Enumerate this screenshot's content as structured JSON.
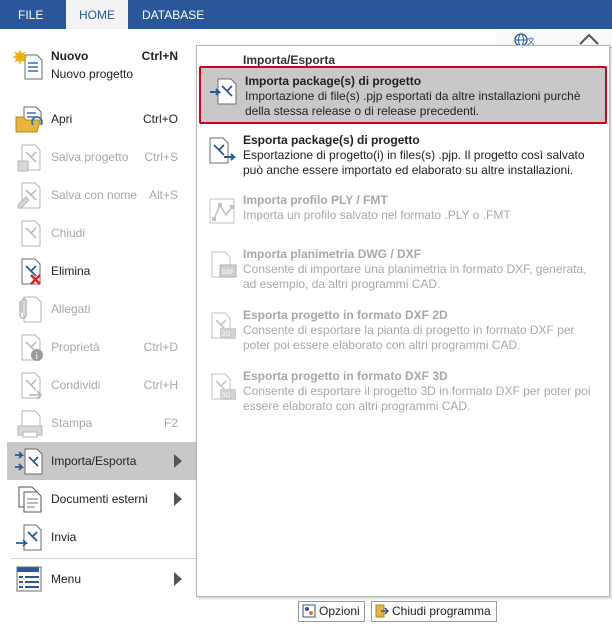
{
  "ribbon": {
    "tabs": [
      "FILE",
      "HOME",
      "DATABASE"
    ],
    "active": "HOME",
    "color": "#2b579a"
  },
  "menu": {
    "nuovo": {
      "title": "Nuovo",
      "subtitle": "Nuovo progetto",
      "shortcut": "Ctrl+N"
    },
    "items": [
      {
        "label": "Apri",
        "shortcut": "Ctrl+O",
        "icon": "open-folder-icon"
      },
      {
        "label": "Salva progetto",
        "shortcut": "Ctrl+S",
        "icon": "save-icon"
      },
      {
        "label": "Salva con nome",
        "shortcut": "Alt+S",
        "icon": "save-as-icon"
      },
      {
        "label": "Chiudi",
        "shortcut": "",
        "icon": "close-document-icon"
      },
      {
        "label": "Elimina",
        "shortcut": "",
        "icon": "delete-icon"
      },
      {
        "label": "Allegati",
        "shortcut": "",
        "icon": "paperclip-icon"
      },
      {
        "label": "Proprietà",
        "shortcut": "Ctrl+D",
        "icon": "properties-icon"
      },
      {
        "label": "Condividi",
        "shortcut": "Ctrl+H",
        "icon": "share-icon"
      },
      {
        "label": "Stampa",
        "shortcut": "F2",
        "icon": "print-icon"
      },
      {
        "label": "Importa/Esporta",
        "shortcut": "",
        "icon": "import-export-icon"
      },
      {
        "label": "Documenti esterni",
        "shortcut": "",
        "icon": "documents-icon"
      },
      {
        "label": "Invia",
        "shortcut": "",
        "icon": "send-icon"
      },
      {
        "label": "Menu",
        "shortcut": "",
        "icon": "menu-icon"
      }
    ]
  },
  "submenu": {
    "header": "Importa/Esporta",
    "items": [
      {
        "title": "Importa package(s) di progetto",
        "desc": "Importazione di file(s) .pjp esportati da altre installazioni purchè della stessa release o di release precedenti."
      },
      {
        "title": "Esporta package(s) di progetto",
        "desc": "Esportazione di progetto(i) in files(s) .pjp. Il progetto così salvato può anche essere importato ed elaborato su altre installazioni."
      },
      {
        "title": "Importa profilo PLY / FMT",
        "desc": "Importa un profilo salvato nel formato .PLY o .FMT"
      },
      {
        "title": "Importa planimetria DWG / DXF",
        "desc": "Consente di importare una planimetria in formato DXF, generata, ad esempio, da altri programmi CAD."
      },
      {
        "title": "Esporta progetto in formato DXF 2D",
        "desc": "Consente di esportare la pianta di progetto in formato DXF per poter poi essere elaborato con altri programmi CAD."
      },
      {
        "title": "Esporta progetto in formato DXF 3D",
        "desc": "Consente di esportare il progetto 3D in formato DXF per poter poi essere elaborato con altri programmi CAD."
      }
    ]
  },
  "buttons": {
    "options": "Opzioni",
    "close_program": "Chiudi programma"
  }
}
